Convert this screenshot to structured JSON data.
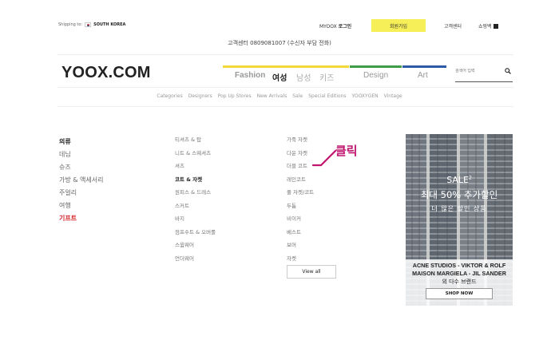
{
  "top": {
    "shipping_label": "Shipping to:",
    "shipping_country": "SOUTH KOREA",
    "myyoox_prefix": "MYOOX",
    "myyoox_login": "로그인",
    "join": "회원가입",
    "customer_center": "고객센터",
    "shopping_bag": "쇼핑백",
    "hotline": "고객센터 0809081007 (수신자 부담 전화)"
  },
  "logo": "YOOX.COM",
  "main_nav": {
    "fashion": "Fashion",
    "women": "여성",
    "men": "남성",
    "kids": "키즈",
    "design": "Design",
    "art": "Art"
  },
  "search": {
    "placeholder": "검색어 입력"
  },
  "sub_nav": [
    "Categories",
    "Designers",
    "Pop Up Stores",
    "New Arrivals",
    "Sale",
    "Special Editions",
    "YOOXYGEN",
    "Vintage"
  ],
  "categories": [
    "의류",
    "데님",
    "슈즈",
    "가방 & 액세서리",
    "주얼리",
    "여행",
    "기프트"
  ],
  "subcategories": [
    "티셔츠 & 탑",
    "니트 & 스웨셔츠",
    "셔츠",
    "코트 & 자켓",
    "원피스 & 드레스",
    "스커트",
    "바지",
    "점프수트 & 오버롤",
    "스윔웨어",
    "언더웨어"
  ],
  "coats": [
    "가죽 자켓",
    "다운 자켓",
    "더블 코트",
    "레인코트",
    "풀 자켓/코트",
    "두툼",
    "비이커",
    "베스트",
    "보머",
    "자켓"
  ],
  "view_all": "View all",
  "callout": "클릭",
  "banner": {
    "sale": "SALE",
    "sale_sup": "2",
    "discount": "최대 50% 추가할인",
    "tagline": "더 많은 할인 상품",
    "brands_line1": "ACNE STUDIOS - VIKTOR & ROLF",
    "brands_line2": "MAISON MARGIELA - JIL SANDER",
    "brands_line3": "외 다수 브랜드",
    "cta": "SHOP NOW"
  },
  "colors": {
    "join_bg": "#f7ef57",
    "fashion_bar": "#f3d83a",
    "design_bar": "#3f9d4a",
    "art_bar": "#2d5aa8",
    "highlight": "#c0156e",
    "gift_red": "#d4232a"
  }
}
